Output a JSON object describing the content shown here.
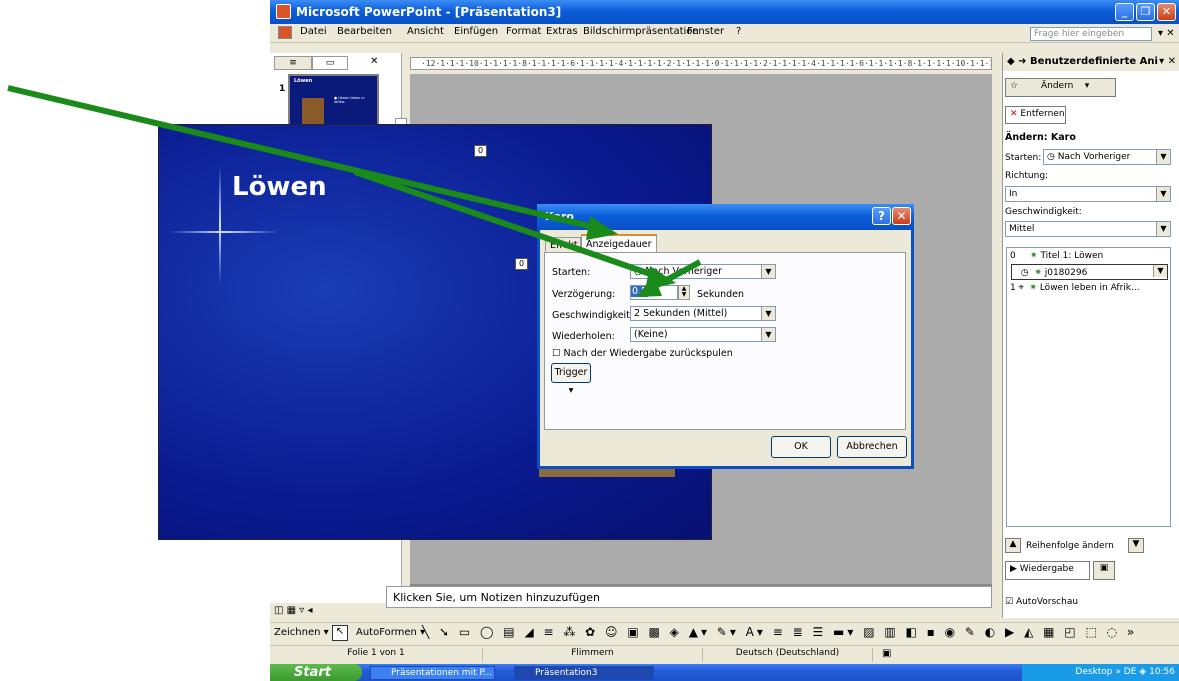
{
  "window": {
    "title": "Microsoft PowerPoint - [Präsentation3]"
  },
  "menu": {
    "items": [
      "Datei",
      "Bearbeiten",
      "Ansicht",
      "Einfügen",
      "Format",
      "Extras",
      "Bildschirmpräsentation",
      "Fenster",
      "?"
    ],
    "search_placeholder": "Frage hier eingeben"
  },
  "slides_pane": {
    "slide_number": "1",
    "thumb_title": "Löwen",
    "thumb_text": "● Löwen leben in Afrika."
  },
  "ruler": {
    "top": "·12·1·1·1·10·1·1·1·1·8·1·1·1·1·6·1·1·1·1·4·1·1·1·1·2·1·1·1·1·0·1·1·1·1·2·1·1·1·1·4·1·1·1·1·6·1·1·1·1·8·1·1·1·1·10·1·1·1·1·12·1"
  },
  "slide": {
    "title": "Löwen",
    "tag_title": "0",
    "tag_bullet": "0"
  },
  "notes": {
    "placeholder": "Klicken Sie, um Notizen hinzuzufügen"
  },
  "task_pane": {
    "header": "Benutzerdefinierte Ani",
    "change_button": "Ändern",
    "remove_button": "Entfernen",
    "section_title": "Ändern: Karo",
    "start_label": "Starten:",
    "start_value": "Nach Vorheriger",
    "direction_label": "Richtung:",
    "direction_value": "In",
    "speed_label": "Geschwindigkeit:",
    "speed_value": "Mittel",
    "items": [
      {
        "num": "0",
        "text": "Titel 1: Löwen"
      },
      {
        "num": "",
        "text": "j0180296"
      },
      {
        "num": "1",
        "text": "Löwen leben in Afrik..."
      }
    ],
    "reorder_label": "Reihenfolge ändern",
    "play_button": "Wiedergabe",
    "autopreview_label": "AutoVorschau"
  },
  "drawing_toolbar": {
    "draw_label": "Zeichnen",
    "autoshapes_label": "AutoFormen"
  },
  "status_bar": {
    "slide": "Folie 1 von 1",
    "design": "Flimmern",
    "language": "Deutsch (Deutschland)"
  },
  "taskbar": {
    "start": "Start",
    "items": [
      "Präsentationen mit P...",
      "Präsentation3"
    ],
    "desktop": "Desktop",
    "lang": "DE",
    "time": "10:56"
  },
  "dialog": {
    "title": "Karo",
    "tabs": [
      "Effekt",
      "Anzeigedauer"
    ],
    "start_label": "Starten:",
    "start_value": "Nach Vorheriger",
    "delay_label": "Verzögerung:",
    "delay_value": "0,5",
    "delay_unit": "Sekunden",
    "speed_label": "Geschwindigkeit:",
    "speed_value": "2 Sekunden (Mittel)",
    "repeat_label": "Wiederholen:",
    "repeat_value": "(Keine)",
    "rewind_label": "Nach der Wiedergabe zurückspulen",
    "trigger_button": "Trigger",
    "ok_button": "OK",
    "cancel_button": "Abbrechen"
  },
  "colors": {
    "arrow": "#1a8a1a",
    "xp_blue": "#0a5ed9",
    "slide_bg": "#0a1a90"
  }
}
